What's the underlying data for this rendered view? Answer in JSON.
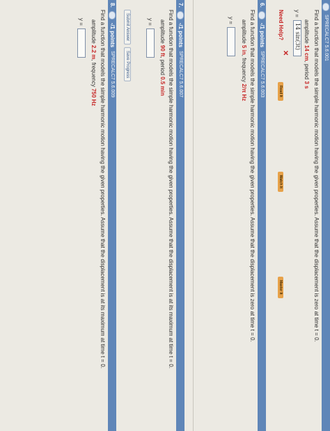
{
  "q5": {
    "source": "SPRECALC7 5.6.001",
    "prompt": "Find a function that models the simple harmonic motion having the given properties. Assume that the displacement is zero at time t = 0.",
    "params_prefix": "amplitude ",
    "amplitude": "14 cm",
    "params_mid": ", period ",
    "period": "3 s",
    "y_label": "y =",
    "answer_value": "14 sin(3t)",
    "incorrect_mark": "✕",
    "need_help_label": "Need Help?",
    "help_buttons": [
      "Read It",
      "Watch It",
      "Master It"
    ]
  },
  "q6": {
    "number": "6.",
    "points": "-/1 points",
    "source": "SPRECALC7 5.6.003",
    "prompt": "Find a function that models the simple harmonic motion having the given properties. Assume that the displacement is zero at time t = 0.",
    "params_prefix": "amplitude ",
    "amplitude": "5 in",
    "params_mid": ", frequency ",
    "frequency": "2/π Hz",
    "y_label": "y ="
  },
  "q7": {
    "number": "7.",
    "points": "-/1 points",
    "source": "SPRECALC7 5.6.007",
    "prompt": "Find a function that models the simple harmonic motion having the given properties. Assume that the displacement is at its maximum at time t = 0.",
    "params_prefix": "amplitude ",
    "amplitude": "90 ft",
    "params_mid": ", period ",
    "period": "0.5 min",
    "y_label": "y =",
    "submit_label": "Submit Answer",
    "save_label": "Save Progress"
  },
  "q8": {
    "number": "8.",
    "points": "-/1 points",
    "source": "SPRECALC7 5.6.009",
    "prompt": "Find a function that models the simple harmonic motion having the given properties. Assume that the displacement is at its maximum at time t = 0.",
    "params_prefix": "amplitude ",
    "amplitude": "2.2 m",
    "params_mid": ", frequency ",
    "frequency": "750 Hz",
    "y_label": "y ="
  },
  "colors": {
    "header": "#5f86b8",
    "accent_red": "#c62626",
    "help_button": "#e7a24a"
  }
}
